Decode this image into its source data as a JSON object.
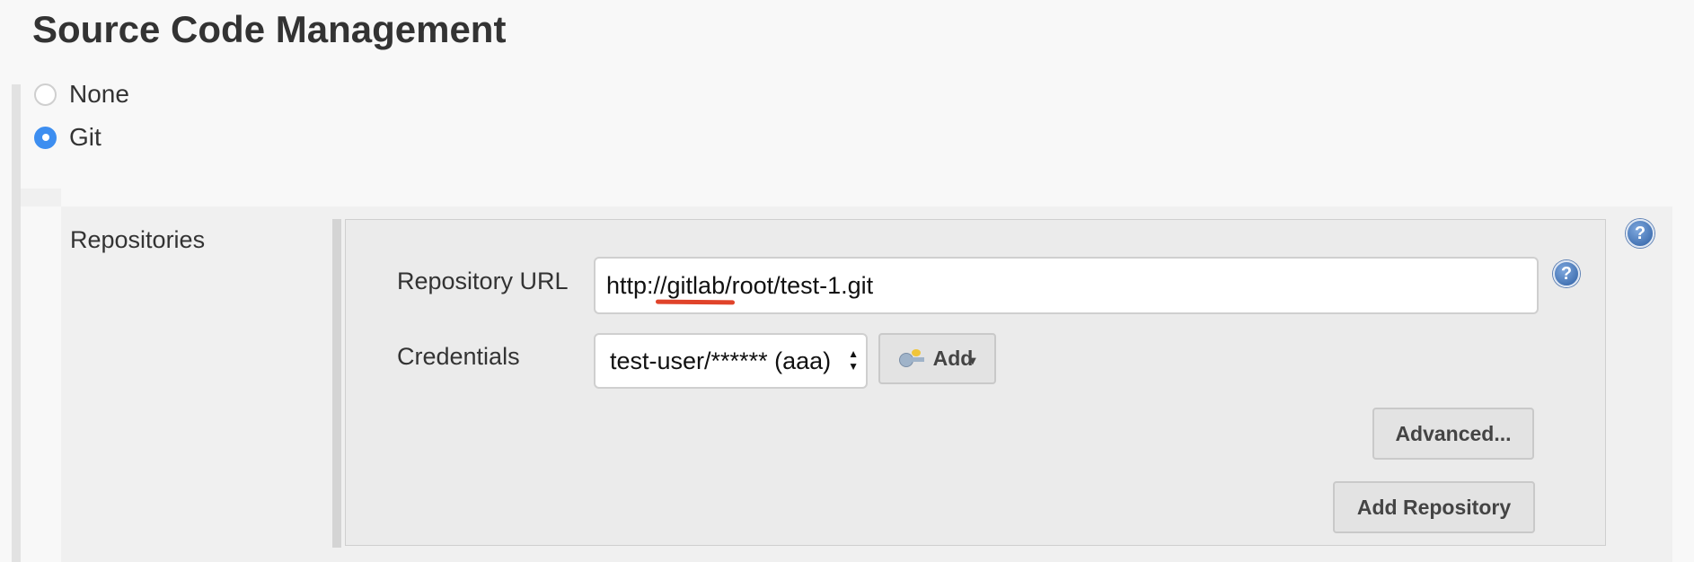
{
  "section": {
    "title": "Source Code Management"
  },
  "scm_options": [
    {
      "label": "None",
      "selected": false
    },
    {
      "label": "Git",
      "selected": true
    }
  ],
  "git": {
    "repositories_label": "Repositories",
    "repository_url": {
      "label": "Repository URL",
      "value": "http://gitlab/root/test-1.git"
    },
    "credentials": {
      "label": "Credentials",
      "selected": "test-user/****** (aaa)"
    },
    "add_button_label": "Add",
    "advanced_button_label": "Advanced...",
    "add_repository_button_label": "Add Repository",
    "help_icon_glyph": "?"
  },
  "colors": {
    "accent": "#3d8ef0",
    "annotation_underline": "#e0432a",
    "help_icon": "#2d5fa3"
  },
  "icons": [
    "help-icon",
    "key-icon",
    "dropdown-caret-icon",
    "select-arrows-icon"
  ]
}
